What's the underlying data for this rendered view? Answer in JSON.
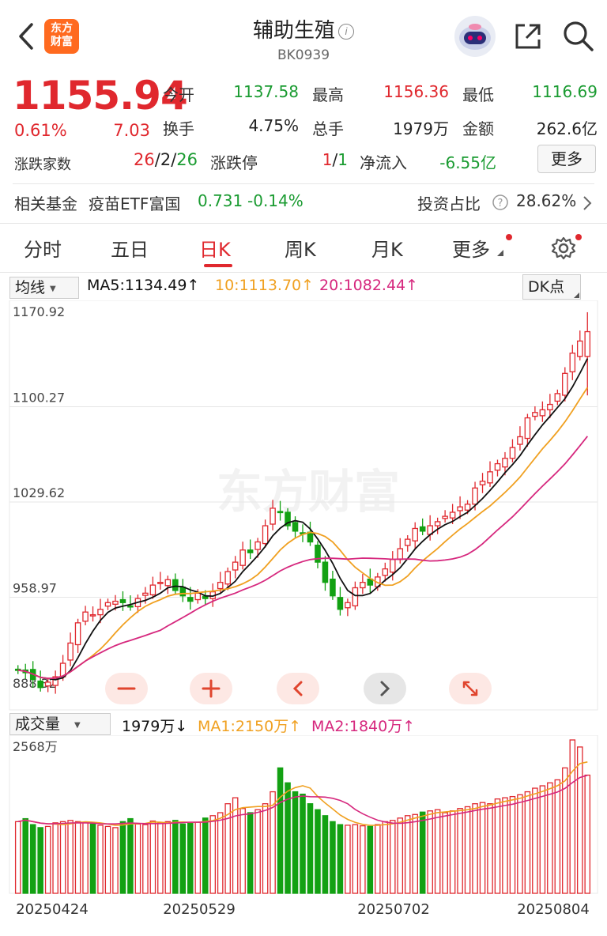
{
  "header": {
    "back_icon": "chevron-left-icon",
    "logo_line1": "东方",
    "logo_line2": "财富",
    "title": "辅助生殖",
    "code": "BK0939",
    "info_icon": "info-circle-icon",
    "robot_icon": "robot-avatar-icon",
    "share_icon": "share-icon",
    "search_icon": "search-icon"
  },
  "quote": {
    "price": "1155.94",
    "change_pct": "0.61%",
    "change": "7.03",
    "open_label": "今开",
    "open": "1137.58",
    "high_label": "最高",
    "high": "1156.36",
    "low_label": "最低",
    "low": "1116.69",
    "turnover_label": "换手",
    "turnover": "4.75%",
    "volume_label": "总手",
    "volume": "1979万",
    "amount_label": "金额",
    "amount": "262.6亿",
    "breadth_label": "涨跌家数",
    "breadth_up": "26",
    "breadth_sep1": "/",
    "breadth_flat": "2",
    "breadth_sep2": "/",
    "breadth_down": "26",
    "limit_label": "涨跌停",
    "limit_up": "1",
    "limit_sep": "/",
    "limit_down": "1",
    "netflow_label": "净流入",
    "netflow": "-6.55亿",
    "more_button": "更多"
  },
  "fund": {
    "label": "相关基金",
    "name": "疫苗ETF富国",
    "price": "0.731",
    "change": "-0.14%",
    "ratio_label": "投资占比",
    "ratio": "28.62%"
  },
  "tabs": [
    "分时",
    "五日",
    "日K",
    "周K",
    "月K",
    "更多"
  ],
  "active_tab": "日K",
  "chart_header": {
    "indicator": "均线",
    "ma5": "MA5:1134.49↑",
    "ma10": "10:1113.70↑",
    "ma20": "20:1082.44↑",
    "dk_button": "DK点"
  },
  "volume_header": {
    "indicator": "成交量",
    "vol": "1979万↓",
    "ma1": "MA1:2150万↑",
    "ma2": "MA2:1840万↑"
  },
  "colors": {
    "up": "#e0282e",
    "down": "#13a113",
    "ma5": "#111111",
    "ma10": "#f0a020",
    "ma20": "#d6287e"
  },
  "chart_data": {
    "type": "candlestick",
    "price_axis_labels": [
      "1170.92",
      "1100.27",
      "1029.62",
      "958.97",
      "888.32"
    ],
    "ylim": [
      888.32,
      1170.92
    ],
    "volume_axis_label": "2568万",
    "volume_max": 2568,
    "x_tick_labels": [
      "20250424",
      "20250529",
      "20250702",
      "20250804"
    ],
    "watermark": "东方财富",
    "closes": [
      905,
      903,
      898,
      892,
      896,
      900,
      910,
      925,
      940,
      948,
      946,
      950,
      955,
      956,
      955,
      952,
      958,
      962,
      968,
      970,
      972,
      964,
      960,
      956,
      962,
      958,
      963,
      970,
      978,
      985,
      994,
      992,
      1000,
      1012,
      1025,
      1022,
      1012,
      1008,
      1006,
      1000,
      985,
      970,
      960,
      950,
      955,
      966,
      970,
      968,
      974,
      980,
      987,
      995,
      1002,
      1010,
      1008,
      1012,
      1015,
      1019,
      1022,
      1026,
      1028,
      1040,
      1045,
      1052,
      1058,
      1062,
      1070,
      1078,
      1092,
      1096,
      1098,
      1102,
      1110,
      1125,
      1140,
      1149,
      1155.94
    ],
    "volume": [
      1200,
      1250,
      1150,
      1100,
      1120,
      1180,
      1200,
      1220,
      1200,
      1180,
      1160,
      1140,
      1120,
      1100,
      1200,
      1250,
      1160,
      1150,
      1210,
      1180,
      1200,
      1220,
      1160,
      1180,
      1190,
      1260,
      1300,
      1350,
      1500,
      1600,
      1420,
      1350,
      1400,
      1500,
      1700,
      2100,
      1850,
      1700,
      1660,
      1500,
      1400,
      1300,
      1200,
      1150,
      1140,
      1150,
      1130,
      1120,
      1150,
      1200,
      1220,
      1260,
      1300,
      1320,
      1360,
      1380,
      1400,
      1350,
      1380,
      1420,
      1450,
      1500,
      1520,
      1500,
      1580,
      1600,
      1620,
      1650,
      1700,
      1760,
      1800,
      1850,
      1900,
      2100,
      2568,
      2450,
      1979
    ]
  }
}
